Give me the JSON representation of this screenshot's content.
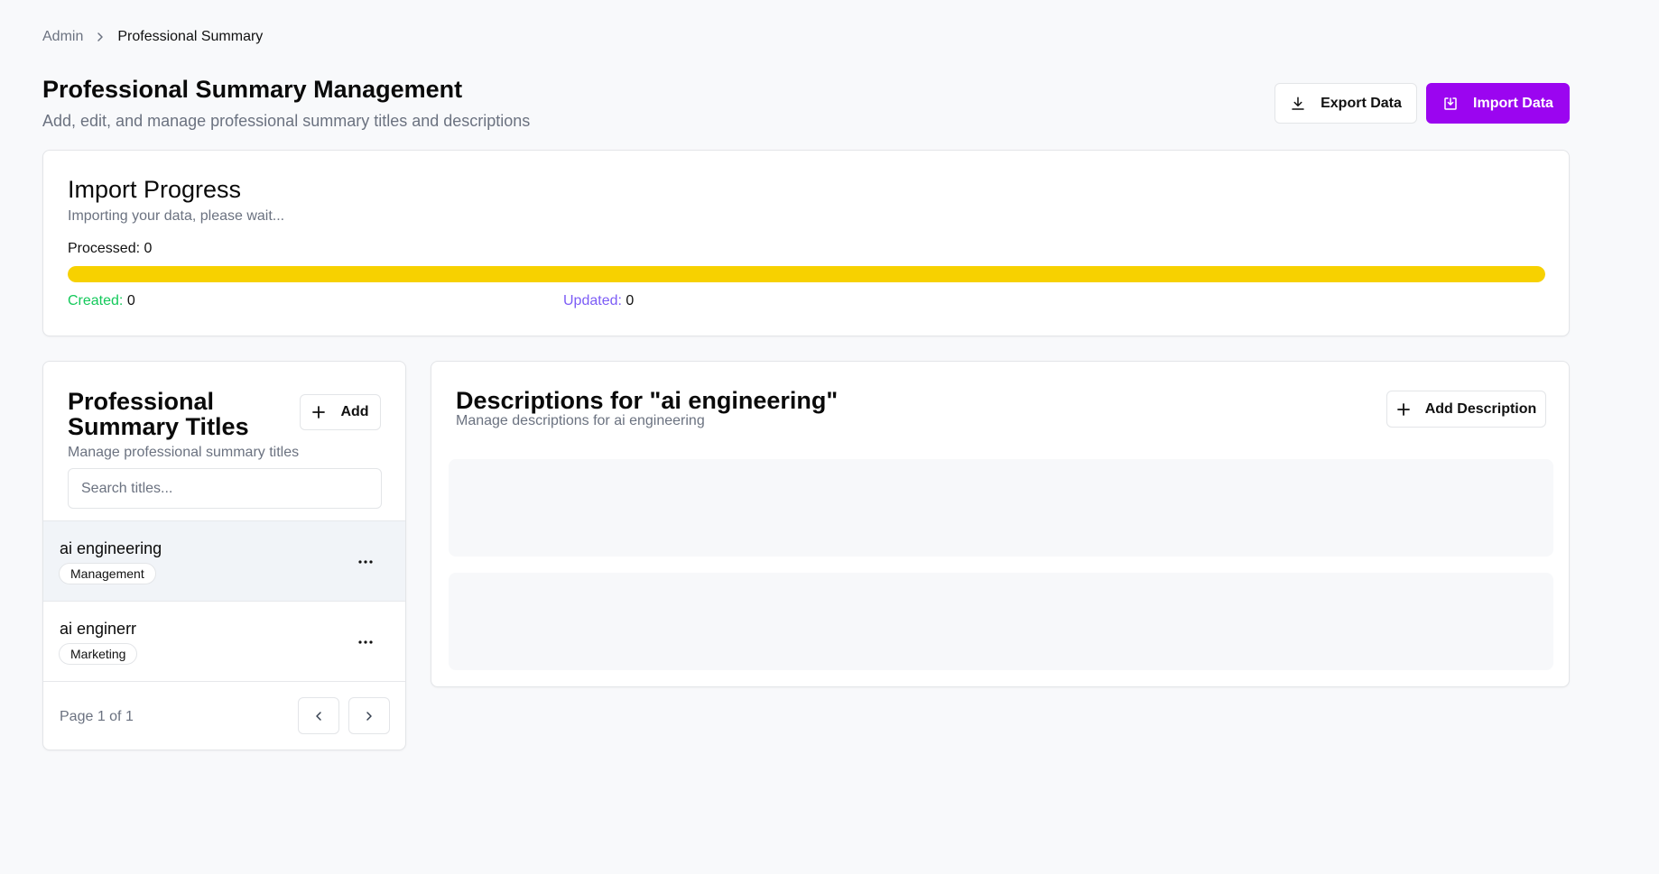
{
  "breadcrumb": {
    "root": "Admin",
    "current": "Professional Summary"
  },
  "header": {
    "title": "Professional Summary Management",
    "subtitle": "Add, edit, and manage professional summary titles and descriptions",
    "export_label": "Export Data",
    "import_label": "Import Data"
  },
  "import_progress": {
    "title": "Import Progress",
    "subtitle": "Importing your data, please wait...",
    "processed_label": "Processed: 0",
    "progress_fraction": 1.0,
    "created_label": "Created:",
    "created_value": "0",
    "updated_label": "Updated:",
    "updated_value": "0"
  },
  "titles_panel": {
    "heading": "Professional Summary Titles",
    "add_label": "Add",
    "subtitle": "Manage professional summary titles",
    "search_placeholder": "Search titles...",
    "items": [
      {
        "name": "ai engineering",
        "badge": "Management",
        "selected": true
      },
      {
        "name": "ai enginerr",
        "badge": "Marketing",
        "selected": false
      }
    ],
    "page_info": "Page 1 of 1"
  },
  "descriptions_panel": {
    "title": "Descriptions for \"ai engineering\"",
    "subtitle": "Manage descriptions for ai engineering",
    "add_label": "Add Description"
  },
  "colors": {
    "primary": "#9b05f0",
    "progress": "#f7d100",
    "created": "#14c95b",
    "updated": "#7c5cf6"
  }
}
